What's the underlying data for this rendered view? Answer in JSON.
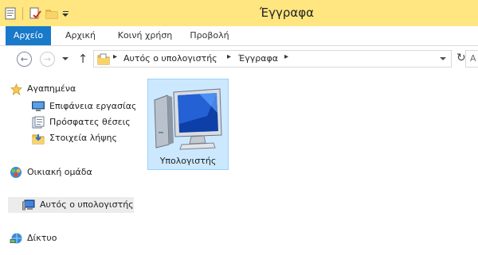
{
  "window": {
    "title": "Έγγραφα"
  },
  "ribbon": {
    "tabs": [
      {
        "label": "Αρχείο",
        "active": true
      },
      {
        "label": "Αρχική"
      },
      {
        "label": "Κοινή χρήση"
      },
      {
        "label": "Προβολή"
      }
    ]
  },
  "address": {
    "breadcrumbs": [
      "Αυτός ο υπολογιστής",
      "Έγγραφα"
    ],
    "search_placeholder": "Α"
  },
  "navpane": {
    "favorites": {
      "label": "Αγαπημένα"
    },
    "favorite_items": [
      {
        "label": "Επιφάνεια εργασίας",
        "icon": "desktop-icon"
      },
      {
        "label": "Πρόσφατες θέσεις",
        "icon": "recent-places-icon"
      },
      {
        "label": "Στοιχεία λήψης",
        "icon": "downloads-icon"
      }
    ],
    "homegroup": {
      "label": "Οικιακή ομάδα"
    },
    "this_pc": {
      "label": "Αυτός ο υπολογιστής",
      "selected": true
    },
    "network": {
      "label": "Δίκτυο"
    }
  },
  "content": {
    "items": [
      {
        "label": "Υπολογιστής",
        "icon": "computer-icon",
        "selected": true
      }
    ]
  },
  "colors": {
    "title_bar": "#ffe680",
    "file_tab": "#1979ca",
    "selection": "#cce8ff",
    "selection_border": "#99d1ff"
  }
}
